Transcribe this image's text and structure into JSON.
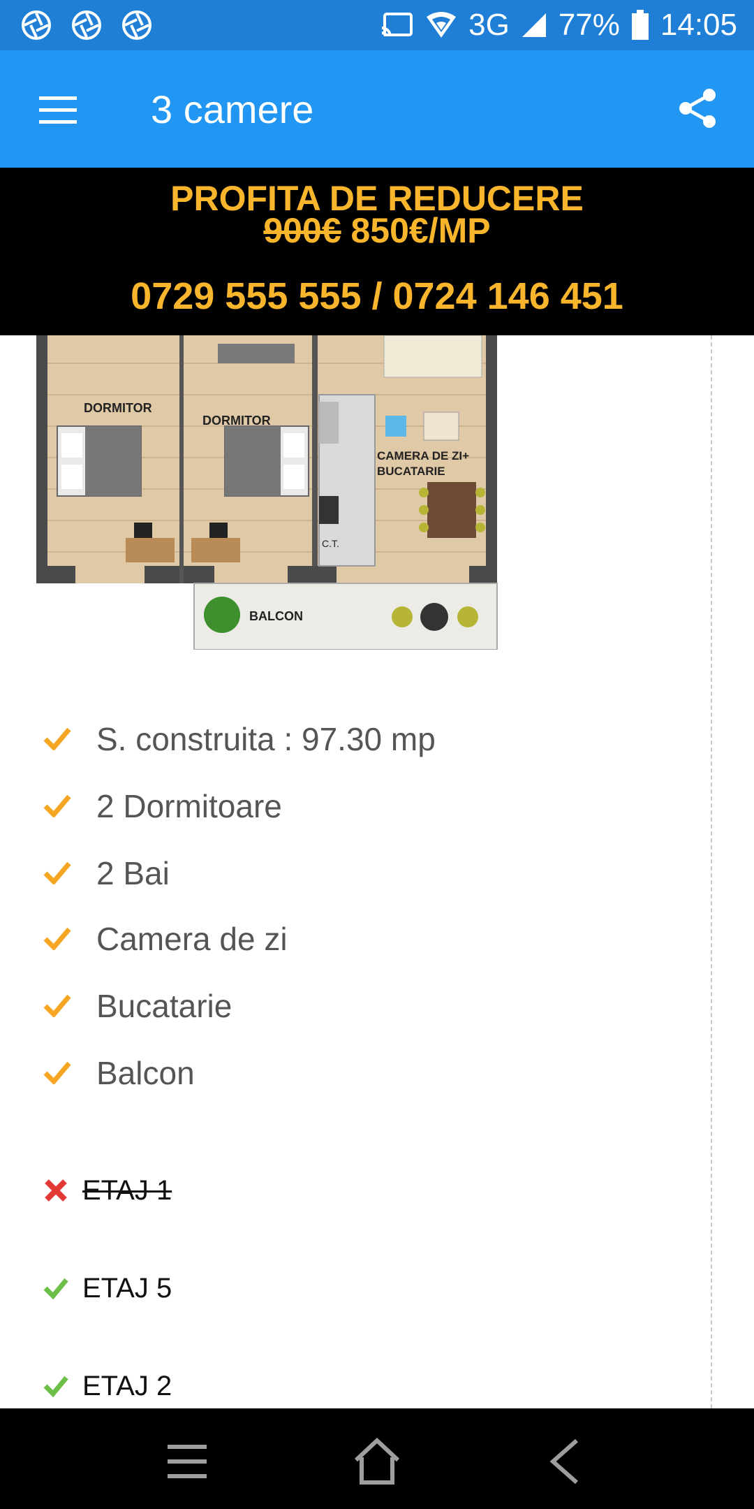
{
  "status_bar": {
    "network": "3G",
    "battery": "77%",
    "time": "14:05",
    "left_icons": [
      "aperture-icon",
      "aperture-icon",
      "aperture-icon"
    ],
    "right_icons": [
      "cast-icon",
      "wifi-icon",
      "signal-icon",
      "battery-icon"
    ]
  },
  "app_bar": {
    "title": "3 camere",
    "menu_icon": "hamburger-menu-icon",
    "share_icon": "share-icon",
    "color": "#2196f3"
  },
  "promo": {
    "title": "PROFITA DE REDUCERE",
    "old_price": "900€",
    "new_price": "850€/MP",
    "phones": "0729 555 555 / 0724 146 451",
    "text_color": "#f9b52b"
  },
  "floor_plan": {
    "rooms": [
      "DORMITOR",
      "DORMITOR",
      "CAMERA DE ZI+",
      "BUCATARIE",
      "BALCON",
      "C.T."
    ]
  },
  "features": [
    "S. construita : 97.30 mp",
    "2 Dormitoare",
    "2 Bai",
    "Camera de zi",
    "Bucatarie",
    "Balcon"
  ],
  "floors": [
    {
      "label": "ETAJ 1",
      "available": false
    },
    {
      "label": "ETAJ 5",
      "available": true
    },
    {
      "label": "ETAJ 2",
      "available": true
    }
  ],
  "nav_bar": {
    "icons": [
      "recent-apps-icon",
      "home-icon",
      "back-icon"
    ]
  }
}
